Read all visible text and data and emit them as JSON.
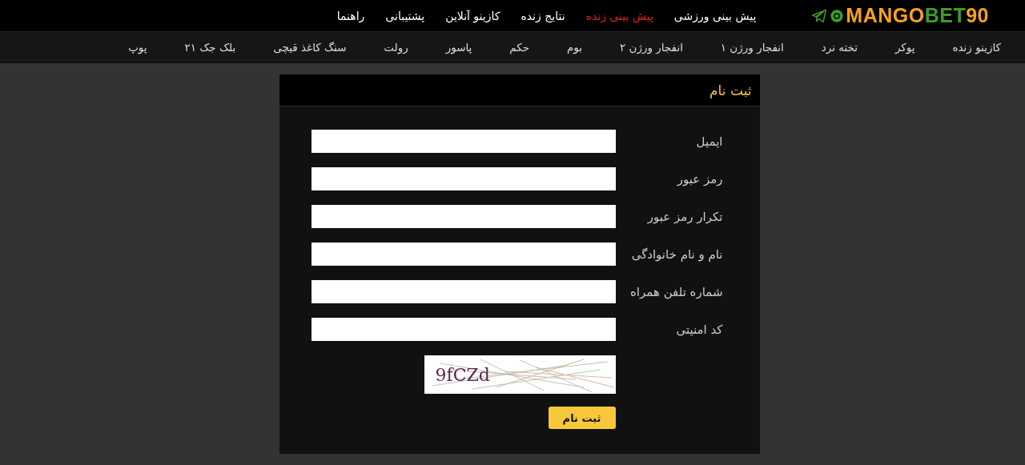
{
  "logo": "MANGO**BET**90",
  "top_nav": [
    {
      "label": "پیش بینی ورزشی",
      "highlighted": false
    },
    {
      "label": "پیش بینی زنده",
      "highlighted": true
    },
    {
      "label": "نتایج زنده",
      "highlighted": false
    },
    {
      "label": "کازینو آنلاین",
      "highlighted": false
    },
    {
      "label": "پشتیبانی",
      "highlighted": false
    },
    {
      "label": "راهنما",
      "highlighted": false
    }
  ],
  "games_nav": [
    "کازینو زنده",
    "پوکر",
    "تخته نرد",
    "انفجار ورژن ۱",
    "انفجار ورژن ۲",
    "بوم",
    "حکم",
    "پاسور",
    "رولت",
    "سنگ کاغذ قیچی",
    "بلک جک ۲۱",
    "پوپ"
  ],
  "form": {
    "title": "ثبت نام",
    "fields": [
      {
        "label": "ایمیل"
      },
      {
        "label": "رمز عبور"
      },
      {
        "label": "تکرار رمز عبور"
      },
      {
        "label": "نام و نام خانوادگی"
      },
      {
        "label": "شماره تلفن همراه"
      },
      {
        "label": "کد امنیتی"
      }
    ],
    "captcha": "9fCZd",
    "submit": "ثبت نام"
  }
}
